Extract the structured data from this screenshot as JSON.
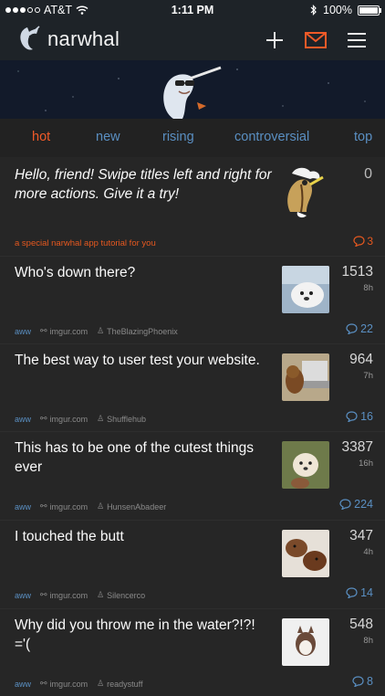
{
  "status_bar": {
    "carrier": "AT&T",
    "time": "1:11 PM",
    "battery": "100%"
  },
  "nav": {
    "brand": "narwhal",
    "icons": [
      "narwhal-logo-icon",
      "plus-icon",
      "mail-icon",
      "menu-icon"
    ]
  },
  "tabs": [
    {
      "label": "hot",
      "active": true
    },
    {
      "label": "new",
      "active": false
    },
    {
      "label": "rising",
      "active": false
    },
    {
      "label": "controversial",
      "active": false
    },
    {
      "label": "top",
      "active": false
    }
  ],
  "tutorial": {
    "text": "Hello, friend! Swipe titles left and right for more actions. Give it a try!",
    "score": "0",
    "subtitle": "a special narwhal app tutorial for you",
    "comments": "3"
  },
  "posts": [
    {
      "title": "Who's down there?",
      "score": "1513",
      "age": "8h",
      "subreddit": "aww",
      "domain": "imgur.com",
      "author": "TheBlazingPhoenix",
      "comments": "22"
    },
    {
      "title": "The best way to user test your website.",
      "score": "964",
      "age": "7h",
      "subreddit": "aww",
      "domain": "imgur.com",
      "author": "Shufflehub",
      "comments": "16"
    },
    {
      "title": "This has to be one of the cutest things ever",
      "score": "3387",
      "age": "16h",
      "subreddit": "aww",
      "domain": "imgur.com",
      "author": "HunsenAbadeer",
      "comments": "224"
    },
    {
      "title": "I touched the butt",
      "score": "347",
      "age": "4h",
      "subreddit": "aww",
      "domain": "imgur.com",
      "author": "Silencerco",
      "comments": "14"
    },
    {
      "title": "Why did you throw me in the water?!?! ='(",
      "score": "548",
      "age": "8h",
      "subreddit": "aww",
      "domain": "imgur.com",
      "author": "readystuff",
      "comments": "8"
    }
  ],
  "colors": {
    "accent_orange": "#f05a28",
    "link_blue": "#5a8fc2",
    "background": "#262626"
  }
}
